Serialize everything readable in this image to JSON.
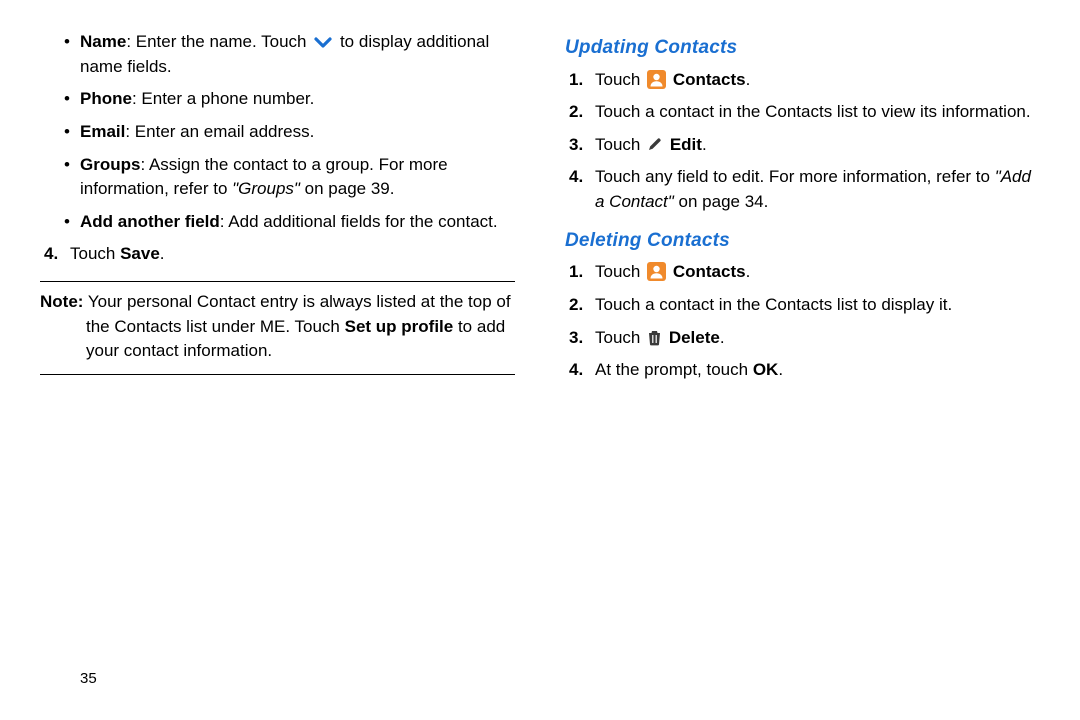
{
  "left": {
    "bullets": {
      "name": {
        "label": "Name",
        "text_before": ": Enter the name. Touch ",
        "text_after": " to display additional name fields."
      },
      "phone": {
        "label": "Phone",
        "text": ": Enter a phone number."
      },
      "email": {
        "label": "Email",
        "text": ": Enter an email address."
      },
      "groups": {
        "label": "Groups",
        "text_main": ": Assign the contact to a group. For more information, refer to ",
        "ref_ital": "\"Groups\"",
        "ref_tail": " on page 39."
      },
      "add_field": {
        "label": "Add another field",
        "text": ": Add additional fields for the contact."
      }
    },
    "step4": {
      "num": "4.",
      "pre": "Touch ",
      "bold": "Save",
      "post": "."
    },
    "note": {
      "label": "Note:",
      "body_1": " Your personal Contact entry is always listed at the top of the Contacts list under ME. Touch ",
      "bold_setup": "Set up profile",
      "body_2": " to add your contact information."
    }
  },
  "right": {
    "updating": {
      "heading": "Updating Contacts",
      "s1": {
        "num": "1.",
        "pre": "Touch ",
        "bold": "Contacts",
        "post": "."
      },
      "s2": {
        "num": "2.",
        "text": "Touch a contact in the Contacts list to view its information."
      },
      "s3": {
        "num": "3.",
        "pre": "Touch ",
        "bold": "Edit",
        "post": "."
      },
      "s4": {
        "num": "4.",
        "pre": "Touch any field to edit. For more information, refer to ",
        "ref_ital": "\"Add a Contact\"",
        "ref_tail": " on page 34."
      }
    },
    "deleting": {
      "heading": "Deleting Contacts",
      "s1": {
        "num": "1.",
        "pre": "Touch ",
        "bold": "Contacts",
        "post": "."
      },
      "s2": {
        "num": "2.",
        "text": "Touch a contact in the Contacts list to display it."
      },
      "s3": {
        "num": "3.",
        "pre": "Touch ",
        "bold": "Delete",
        "post": "."
      },
      "s4": {
        "num": "4.",
        "pre": "At the prompt, touch ",
        "bold": "OK",
        "post": "."
      }
    }
  },
  "page_number": "35"
}
